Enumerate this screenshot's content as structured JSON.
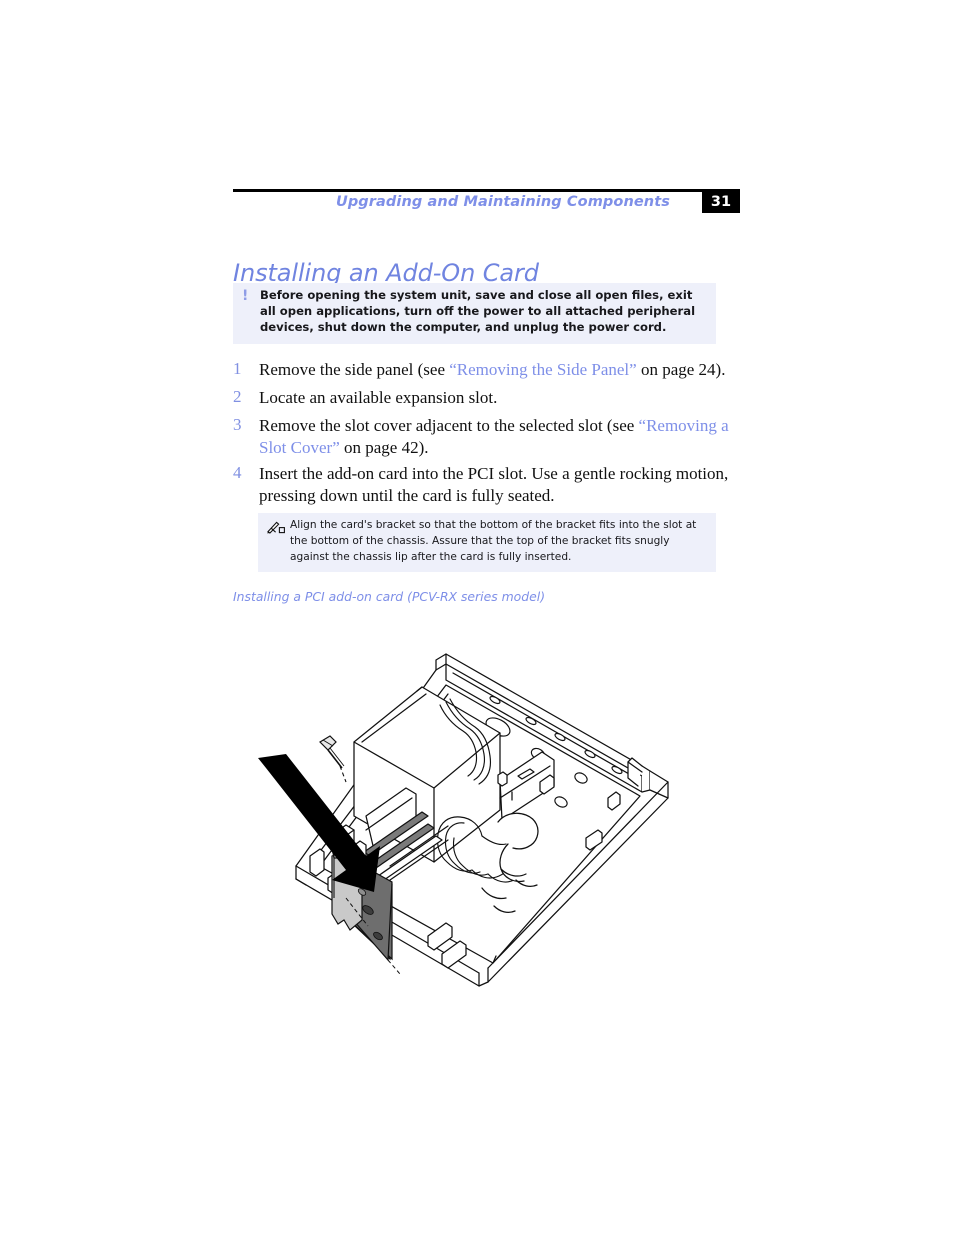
{
  "header": {
    "running_title": "Upgrading and Maintaining Components",
    "page_number": "31",
    "rule_color": "#000000",
    "accent_color": "#7e8fe8"
  },
  "section": {
    "heading": "Installing an Add-On Card",
    "heading_color": "#7084e0"
  },
  "caution": {
    "icon": "exclamation-icon",
    "icon_glyph": "!",
    "text": "Before opening the system unit, save and close all open files, exit all open applications, turn off the power to all attached peripheral devices, shut down the computer, and unplug the power cord.",
    "background": "#eef0fa"
  },
  "steps": [
    {
      "number": "1",
      "segments": [
        {
          "text": "Remove the side panel (see ",
          "style": "plain"
        },
        {
          "text": "“Removing the Side Panel”",
          "style": "xref"
        },
        {
          "text": " on page 24).",
          "style": "plain"
        }
      ]
    },
    {
      "number": "2",
      "segments": [
        {
          "text": "Locate an available expansion slot.",
          "style": "plain"
        }
      ]
    },
    {
      "number": "3",
      "segments": [
        {
          "text": "Remove the slot cover adjacent to the selected slot (see ",
          "style": "plain"
        },
        {
          "text": "“Removing a Slot Cover”",
          "style": "xref"
        },
        {
          "text": " on page 42).",
          "style": "plain"
        }
      ]
    },
    {
      "number": "4",
      "segments": [
        {
          "text": "Insert the add-on card into the PCI slot. Use a gentle rocking motion, pressing down until the card is fully seated.",
          "style": "plain"
        }
      ]
    }
  ],
  "note": {
    "icon": "pencil-note-icon",
    "text": "Align the card's bracket so that the bottom of the bracket fits into the slot at the bottom of the chassis. Assure that the top of the bracket fits snugly against the chassis lip after the card is fully inserted.",
    "background": "#eef0fa"
  },
  "figure": {
    "caption": "Installing a PCI add-on card (PCV-RX series model)",
    "caption_color": "#7e8fe8",
    "description": "Isometric line drawing of an open desktop PC chassis with a PCI add-on card and mounting screw above the expansion slot; a thick black arrow indicates downward insertion direction.",
    "parts": [
      {
        "name": "insertion-arrow",
        "fill": "#000000"
      },
      {
        "name": "mounting-screw",
        "fill": "#f2f2f2"
      },
      {
        "name": "card-bracket",
        "fill": "#c9c9c9"
      },
      {
        "name": "card-board",
        "fill": "#6e6e6e"
      },
      {
        "name": "chassis",
        "fill": "#ffffff"
      },
      {
        "name": "power-supply",
        "fill": "#ffffff"
      }
    ]
  }
}
